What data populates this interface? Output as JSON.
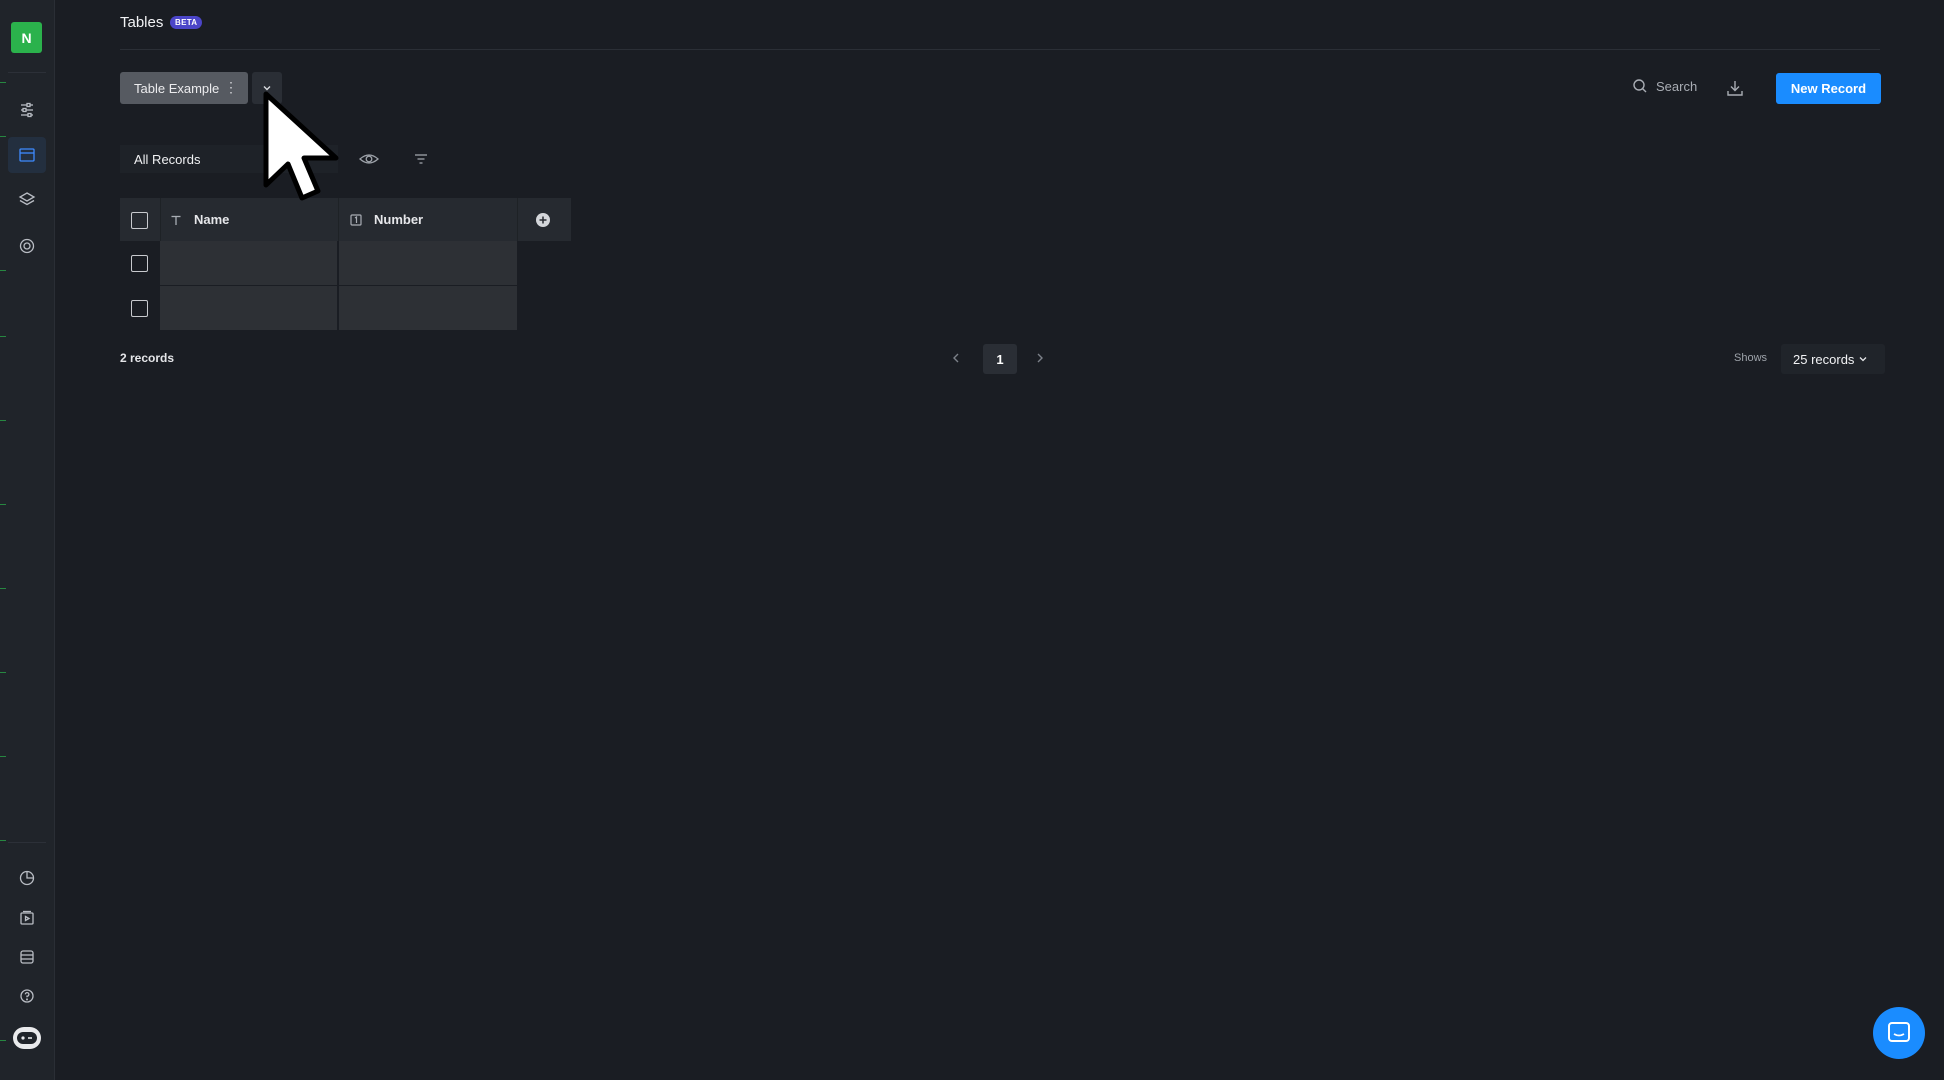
{
  "sidebar": {
    "logo_letter": "N",
    "top_items": [
      {
        "icon": "sliders-icon",
        "active": false
      },
      {
        "icon": "table-icon",
        "active": true
      },
      {
        "icon": "layers-icon",
        "active": false
      },
      {
        "icon": "target-icon",
        "active": false
      }
    ],
    "bottom_items": [
      {
        "icon": "pie-chart-icon"
      },
      {
        "icon": "media-icon"
      },
      {
        "icon": "database-icon"
      },
      {
        "icon": "help-icon"
      },
      {
        "icon": "bot-icon"
      }
    ]
  },
  "header": {
    "title": "Tables",
    "badge": "BETA"
  },
  "table_tab": {
    "label": "Table Example",
    "menu_glyph": "⋮"
  },
  "toolbar": {
    "search_label": "Search",
    "new_record_label": "New Record"
  },
  "view": {
    "selected": "All Records"
  },
  "grid": {
    "columns": [
      {
        "name": "Name",
        "type_icon": "text-type-icon"
      },
      {
        "name": "Number",
        "type_icon": "number-type-icon"
      }
    ],
    "rows": [
      {
        "name": "",
        "number": ""
      },
      {
        "name": "",
        "number": ""
      }
    ]
  },
  "footer": {
    "record_count": "2 records",
    "current_page": "1",
    "shows_label": "Shows",
    "page_size": "25 records"
  },
  "colors": {
    "accent": "#1a8cff",
    "logo": "#2bb24c",
    "badge": "#4b45c8",
    "background": "#1a1d23"
  }
}
